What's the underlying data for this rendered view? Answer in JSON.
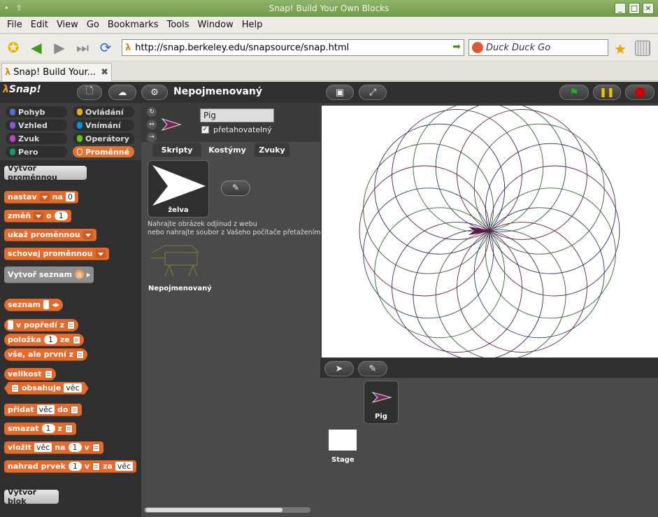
{
  "window": {
    "title": "Snap! Build Your Own Blocks"
  },
  "menu": [
    "File",
    "Edit",
    "View",
    "Go",
    "Bookmarks",
    "Tools",
    "Window",
    "Help"
  ],
  "nav": {
    "url": "http://snap.berkeley.edu/snapsource/snap.html",
    "search": "Duck Duck Go"
  },
  "tab": {
    "label": "Snap! Build Your..."
  },
  "snap": {
    "logo": "Snap!",
    "project_title": "Nepojmenovaný",
    "categories": {
      "left": [
        "Pohyb",
        "Vzhled",
        "Zvuk",
        "Pero"
      ],
      "right": [
        "Ovládání",
        "Vnímání",
        "Operátory",
        "Proměnné"
      ],
      "left_colors": [
        "#4a6cd4",
        "#8a55d7",
        "#bb42c3",
        "#0e9a6c"
      ],
      "right_colors": [
        "#e6a822",
        "#0494dc",
        "#62c213",
        "#e6732b"
      ],
      "selected": "Proměnné"
    },
    "palette": {
      "make_var": "Vytvoř proměnnou",
      "set": "nastav",
      "set_to": "na",
      "set_val": "0",
      "change": "změň",
      "change_by": "o",
      "change_val": "1",
      "show_var": "ukaž proměnnou",
      "hide_var": "schovej proměnnou",
      "make_list": "Vytvoř seznam",
      "make_list_slot": "a",
      "list": "seznam",
      "in_front": "v popředí z",
      "item": "položka",
      "item_val": "1",
      "item_of": "ze",
      "all_but_first": "vše, ale první z",
      "length": "velikost",
      "contains": "obsahuje",
      "contains_val": "věc",
      "add": "přidat",
      "add_val": "věc",
      "add_to": "do",
      "delete": "smazat",
      "delete_val": "1",
      "delete_of": "z",
      "insert": "vložit",
      "insert_val": "věc",
      "insert_at": "na",
      "insert_idx": "1",
      "insert_in": "v",
      "replace": "nahrad prvek",
      "replace_idx": "1",
      "replace_in": "v",
      "replace_with": "za",
      "replace_val": "věc",
      "make_block": "Vytvoř blok"
    },
    "sprite": {
      "name": "Pig",
      "draggable_label": "přetahovatelný",
      "draggable_checked": "✓",
      "tabs": [
        "Skripty",
        "Kostýmy",
        "Zvuky"
      ],
      "selected_tab": "Kostýmy",
      "costume_name": "želva",
      "hint_line1": "Nahrajte obrázek odjinud z webu",
      "hint_line2": "nebo nahrajte soubor z Vašeho počítače přetažením",
      "unnamed_costume": "Nepojmenovaný"
    },
    "corral": {
      "sprite_label": "Pig",
      "stage_label": "Stage"
    },
    "colors": {
      "accent": "#e6732b",
      "green_flag": "#1fb21f",
      "pause": "#e6c700",
      "stop": "#d00000"
    }
  }
}
